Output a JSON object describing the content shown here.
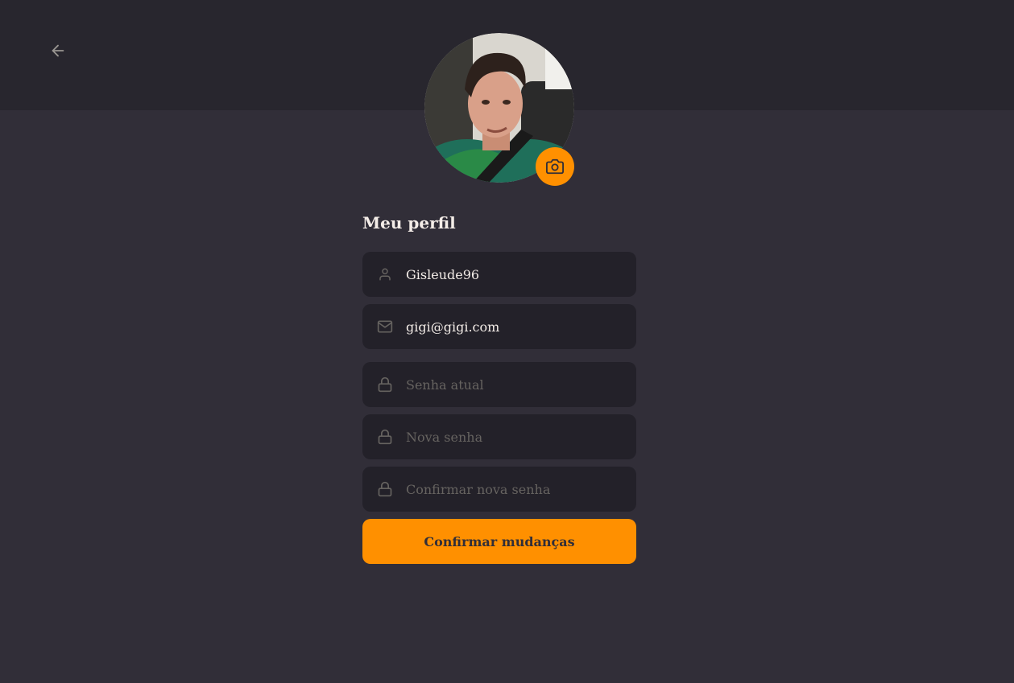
{
  "header": {
    "back_icon": "arrow-left-icon"
  },
  "avatar": {
    "camera_icon": "camera-icon",
    "accent": "#ff9000"
  },
  "profile": {
    "title": "Meu perfil",
    "name_value": "Gisleude96",
    "email_value": "gigi@gigi.com",
    "old_password_placeholder": "Senha atual",
    "new_password_placeholder": "Nova senha",
    "confirm_password_placeholder": "Confirmar nova senha",
    "submit_label": "Confirmar mudanças",
    "icons": {
      "name": "user-icon",
      "email": "mail-icon",
      "password": "lock-icon"
    }
  },
  "colors": {
    "background": "#312e38",
    "header": "#28262e",
    "input": "#232129",
    "text": "#f4ede8",
    "placeholder": "#666360",
    "accent": "#ff9000"
  }
}
